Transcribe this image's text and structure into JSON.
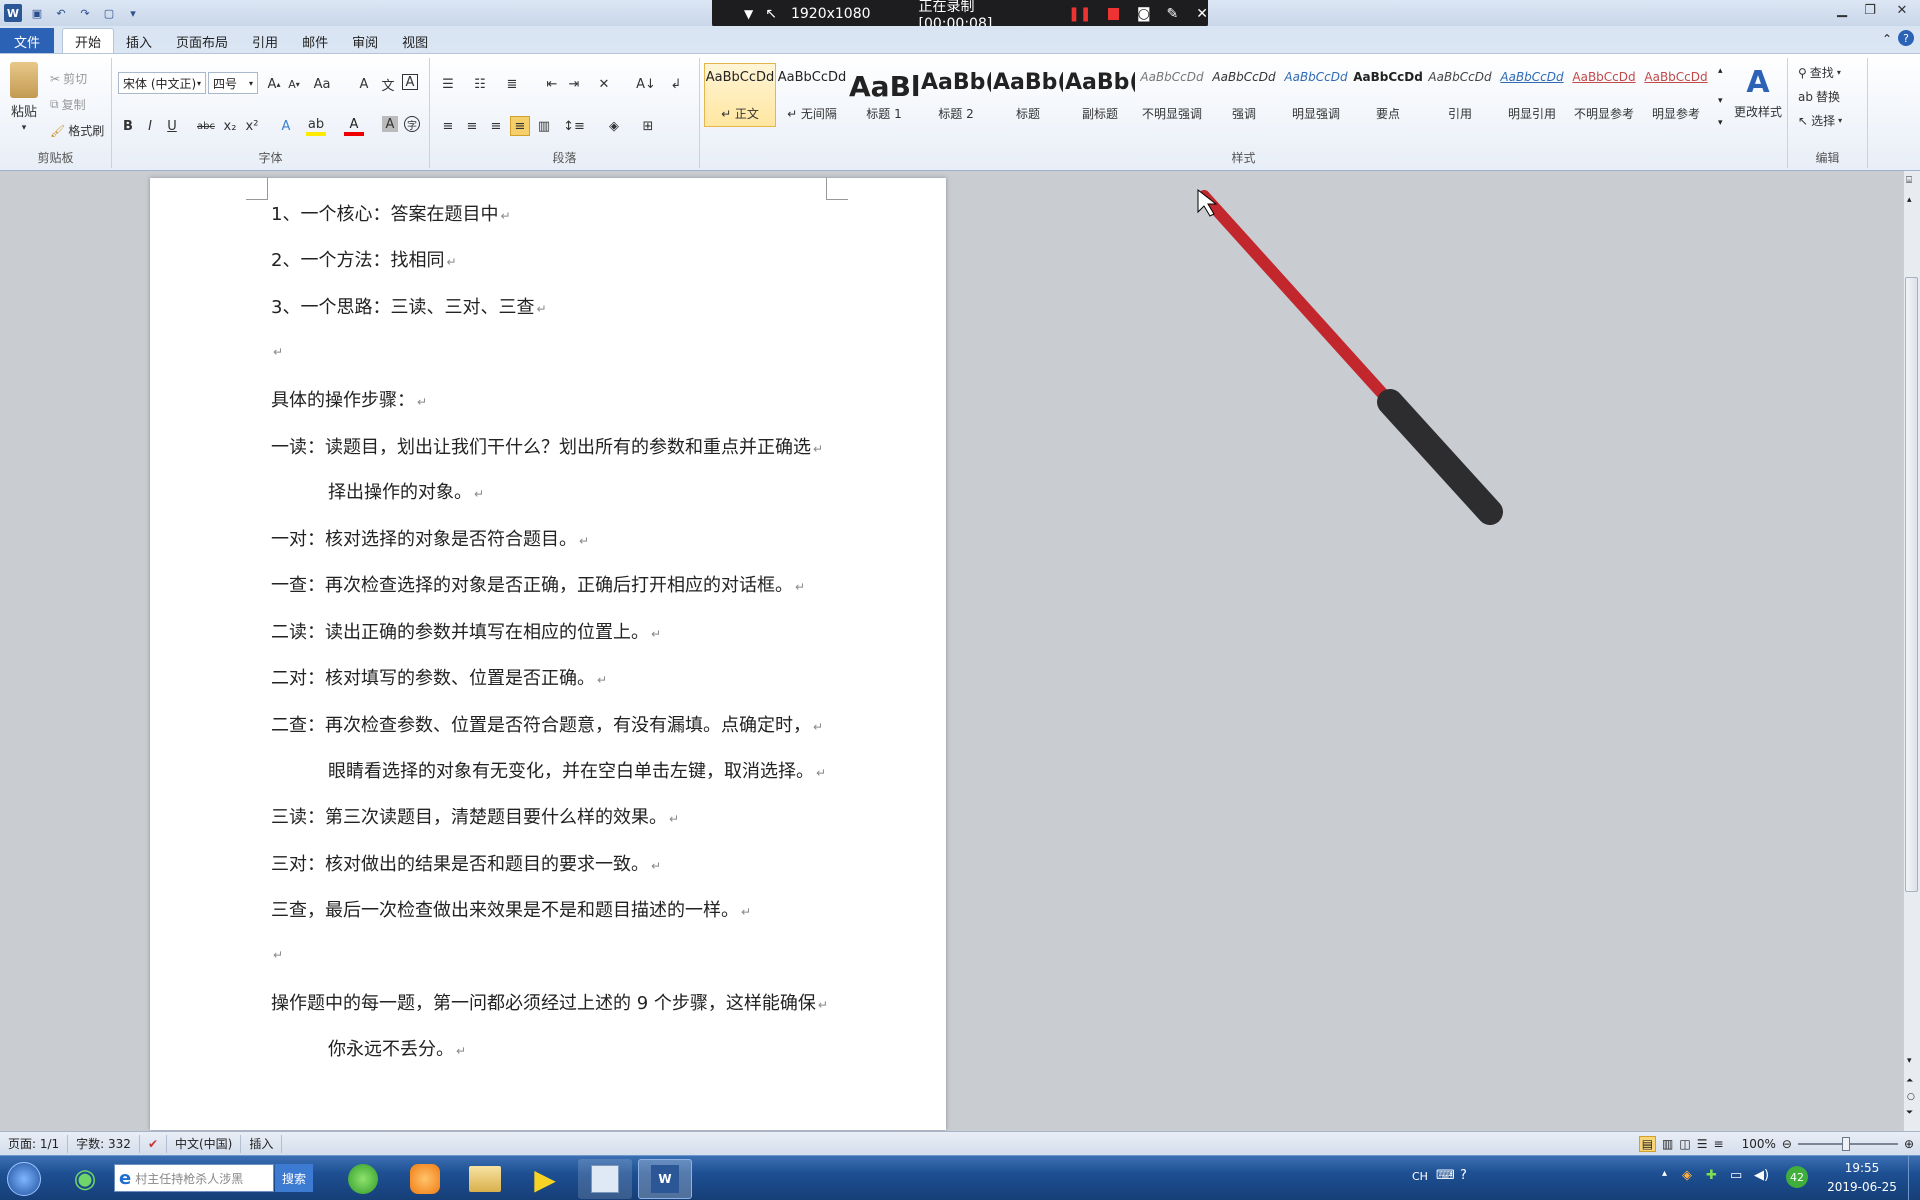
{
  "titlebar": {
    "recording": {
      "resolution": "1920x1080",
      "status": "正在录制 [00:00:08]"
    }
  },
  "ribbon": {
    "tabs": [
      "文件",
      "开始",
      "插入",
      "页面布局",
      "引用",
      "邮件",
      "审阅",
      "视图"
    ],
    "active_tab": "开始",
    "clipboard": {
      "paste": "粘贴",
      "cut": "剪切",
      "copy": "复制",
      "format_painter": "格式刷",
      "label": "剪贴板"
    },
    "font": {
      "name": "宋体 (中文正)",
      "size": "四号",
      "label": "字体"
    },
    "paragraph": {
      "label": "段落"
    },
    "styles": {
      "label": "样式",
      "items": [
        {
          "preview": "AaBbCcDd",
          "name": "↵ 正文",
          "selected": true
        },
        {
          "preview": "AaBbCcDd",
          "name": "↵ 无间隔"
        },
        {
          "preview": "AaBl",
          "name": "标题 1"
        },
        {
          "preview": "AaBb(",
          "name": "标题 2"
        },
        {
          "preview": "AaBb(",
          "name": "标题"
        },
        {
          "preview": "AaBb(",
          "name": "副标题"
        },
        {
          "preview": "AaBbCcDd",
          "name": "不明显强调"
        },
        {
          "preview": "AaBbCcDd",
          "name": "强调"
        },
        {
          "preview": "AaBbCcDd",
          "name": "明显强调"
        },
        {
          "preview": "AaBbCcDd",
          "name": "要点"
        },
        {
          "preview": "AaBbCcDd",
          "name": "引用"
        },
        {
          "preview": "AaBbCcDd",
          "name": "明显引用"
        },
        {
          "preview": "AaBbCcDd",
          "name": "不明显参考"
        },
        {
          "preview": "AaBbCcDd",
          "name": "明显参考"
        }
      ],
      "change_styles": "更改样式"
    },
    "editing": {
      "find": "查找",
      "replace": "替换",
      "select": "选择",
      "label": "编辑"
    }
  },
  "document": {
    "paragraphs": [
      "1、一个核心：答案在题目中",
      "2、一个方法：找相同",
      "3、一个思路：三读、三对、三查",
      "",
      "具体的操作步骤：",
      "一读：读题目，划出让我们干什么？划出所有的参数和重点并正确选",
      "择出操作的对象。",
      "一对：核对选择的对象是否符合题目。",
      "一查：再次检查选择的对象是否正确，正确后打开相应的对话框。",
      "二读：读出正确的参数并填写在相应的位置上。",
      "二对：核对填写的参数、位置是否正确。",
      "二查：再次检查参数、位置是否符合题意，有没有漏填。点确定时，",
      "眼睛看选择的对象有无变化，并在空白单击左键，取消选择。",
      "三读：第三次读题目，清楚题目要什么样的效果。",
      "三对：核对做出的结果是否和题目的要求一致。",
      "三查，最后一次检查做出来效果是不是和题目描述的一样。",
      "",
      "操作题中的每一题，第一问都必须经过上述的 9 个步骤，这样能确保",
      "你永远不丢分。"
    ]
  },
  "statusbar": {
    "page": "页面: 1/1",
    "words": "字数: 332",
    "language": "中文(中国)",
    "mode": "插入",
    "zoom": "100%"
  },
  "taskbar": {
    "search_placeholder": "村主任持枪杀人涉黑",
    "search_button": "搜索",
    "ime": "CH",
    "tray_badge": "42",
    "time": "19:55",
    "date": "2019-06-25"
  },
  "colors": {
    "accent": "#2b62b6",
    "taskbar": "#1d4f92",
    "pen": "#c1272d"
  }
}
